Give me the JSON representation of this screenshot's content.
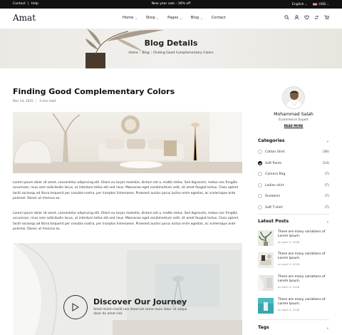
{
  "topbar": {
    "contact": "Contact",
    "separator": "|",
    "help": "Help",
    "announcement": "New year sale - 30% off",
    "language": "English",
    "currency": "USD"
  },
  "header": {
    "logo": "Amat",
    "nav": [
      {
        "label": "Home",
        "dropdown": true
      },
      {
        "label": "Shop",
        "dropdown": true
      },
      {
        "label": "Pages",
        "dropdown": true
      },
      {
        "label": "Blog",
        "dropdown": true
      },
      {
        "label": "Contact",
        "dropdown": false
      }
    ],
    "icons": [
      "search-icon",
      "user-icon",
      "heart-icon",
      "compare-icon",
      "cart-icon"
    ]
  },
  "banner": {
    "title": "Blog Details",
    "breadcrumb": [
      "Home",
      "Blog",
      "Finding Good Complementary Colors"
    ],
    "breadcrumb_sep": "/"
  },
  "article": {
    "title": "Finding Good Complementary Colors",
    "date": "Dec 14, 2025",
    "meta_sep": "|",
    "read_time": "3 min read",
    "para1": "Lorem ipsum dolor sit amet, consectetur adipiscing elit. Etiam eu turpis molestie, dictum est a, mattis tellus. Sed dignissim, metus nec fringilla accumsan, risus sem sollicitudin lacus, ut interdum tellus elit sed risus. Maecenas eget condimentum velit, sit amet feugiat lectus. Class aptent taciti sociosqu ad litora torquent per conubia nostra, per inceptos himenaeos. Praesent auctor purus luctus enim egestas, ac scelerisque ante pulvinar. Donec ut rhoncus ex.",
    "para2": "Lorem ipsum dolor sit amet, consectetur adipiscing elit. Etiam eu turpis molestie, dictum est a, mattis tellus. Sed dignissim, metus nec fringilla accumsan, risus sem sollicitudin lacus, ut interdum tellus elit sed risus. Maecenas eget condimentum velit, sit amet feugiat lectus. Class aptent taciti sociosqu ad litora torquent per conubia nostra, per inceptos himenaeos. Praesent auctor purus luctus enim egestas, ac scelerisque ante pulvinar. Donec ut rhoncus ex.",
    "video_title": "Discover Our Journey",
    "video_text": "Amet minim mollit non deserunt some more dolor sit aliqua dolor do amet sint."
  },
  "sidebar": {
    "author": {
      "name": "Mohammad Salah",
      "role": "Ecommerce Expert",
      "link": "READ MORE"
    },
    "categories_title": "Categories",
    "categories": [
      {
        "name": "Cotton Shirt",
        "count": "(36)",
        "checked": false
      },
      {
        "name": "Soft Pants",
        "count": "(14)",
        "checked": true
      },
      {
        "name": "Camera Bag",
        "count": "(7)",
        "checked": false
      },
      {
        "name": "Ladies shirt",
        "count": "(7)",
        "checked": false
      },
      {
        "name": "Sneakers",
        "count": "(7)",
        "checked": false
      },
      {
        "name": "Soft T-shirt",
        "count": "(7)",
        "checked": false
      }
    ],
    "latest_title": "Latest Posts",
    "posts": [
      {
        "title": "There are many variations of Lorem Ipsum.",
        "date": "on April 4, 2026"
      },
      {
        "title": "There are many variations of Lorem Ipsum.",
        "date": "on April 4, 2026"
      },
      {
        "title": "There are many variations of Lorem Ipsum.",
        "date": "on April 4, 2026"
      },
      {
        "title": "There are many variations of Lorem Ipsum.",
        "date": "on April 4, 2026"
      }
    ],
    "tags_title": "Tags"
  }
}
